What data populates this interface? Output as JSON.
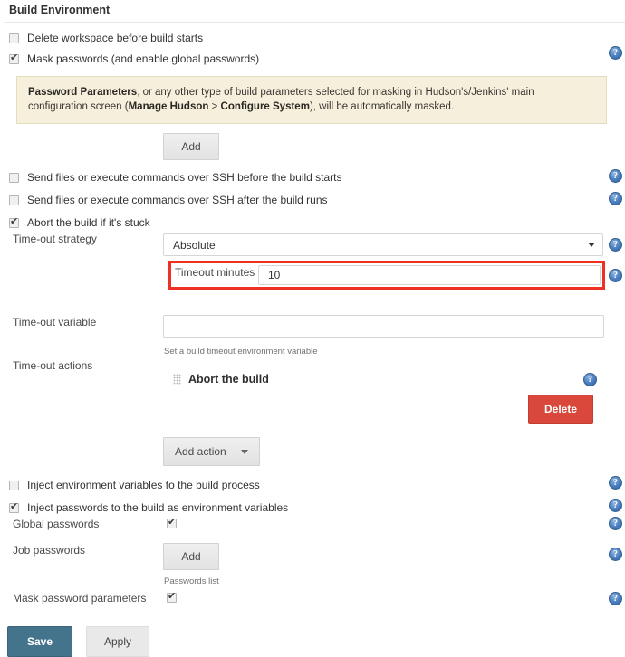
{
  "section": {
    "title": "Build Environment"
  },
  "options": {
    "delete_workspace": {
      "label": "Delete workspace before build starts",
      "checked": false
    },
    "mask_passwords": {
      "label": "Mask passwords (and enable global passwords)",
      "checked": true
    },
    "ssh_before": {
      "label": "Send files or execute commands over SSH before the build starts",
      "checked": false
    },
    "ssh_after": {
      "label": "Send files or execute commands over SSH after the build runs",
      "checked": false
    },
    "abort_if_stuck": {
      "label": "Abort the build if it's stuck",
      "checked": true
    },
    "inject_env_vars": {
      "label": "Inject environment variables to the build process",
      "checked": false
    },
    "inject_passwords": {
      "label": "Inject passwords to the build as environment variables",
      "checked": true
    }
  },
  "notice": {
    "bold_lead": "Password Parameters",
    "text_1": ", or any other type of build parameters selected for masking in Hudson's/Jenkins' main configuration screen (",
    "bold_link_1": "Manage Hudson",
    "separator": " > ",
    "bold_link_2": "Configure System",
    "text_2": "), will be automatically masked."
  },
  "buttons": {
    "add_mask": "Add",
    "add_action": "Add action",
    "delete": "Delete",
    "add_password": "Add",
    "save": "Save",
    "apply": "Apply"
  },
  "timeout": {
    "strategy_label": "Time-out strategy",
    "strategy_value": "Absolute",
    "minutes_label": "Timeout minutes",
    "minutes_value": "10",
    "variable_label": "Time-out variable",
    "variable_value": "",
    "variable_hint": "Set a build timeout environment variable",
    "actions_label": "Time-out actions",
    "action_item": "Abort the build"
  },
  "passwords": {
    "global_label": "Global passwords",
    "global_checked": true,
    "job_label": "Job passwords",
    "job_hint": "Passwords list",
    "mask_params_label": "Mask password parameters",
    "mask_params_checked": true
  },
  "colors": {
    "highlight": "#ef3124",
    "delete_button": "#d9483b",
    "save_button": "#44738c",
    "notice_background": "#f5efdc",
    "help_icon": "#4a7fc1"
  },
  "icons": {
    "help": "help-icon",
    "caret": "chevron-down-icon",
    "grip": "drag-handle-icon"
  }
}
